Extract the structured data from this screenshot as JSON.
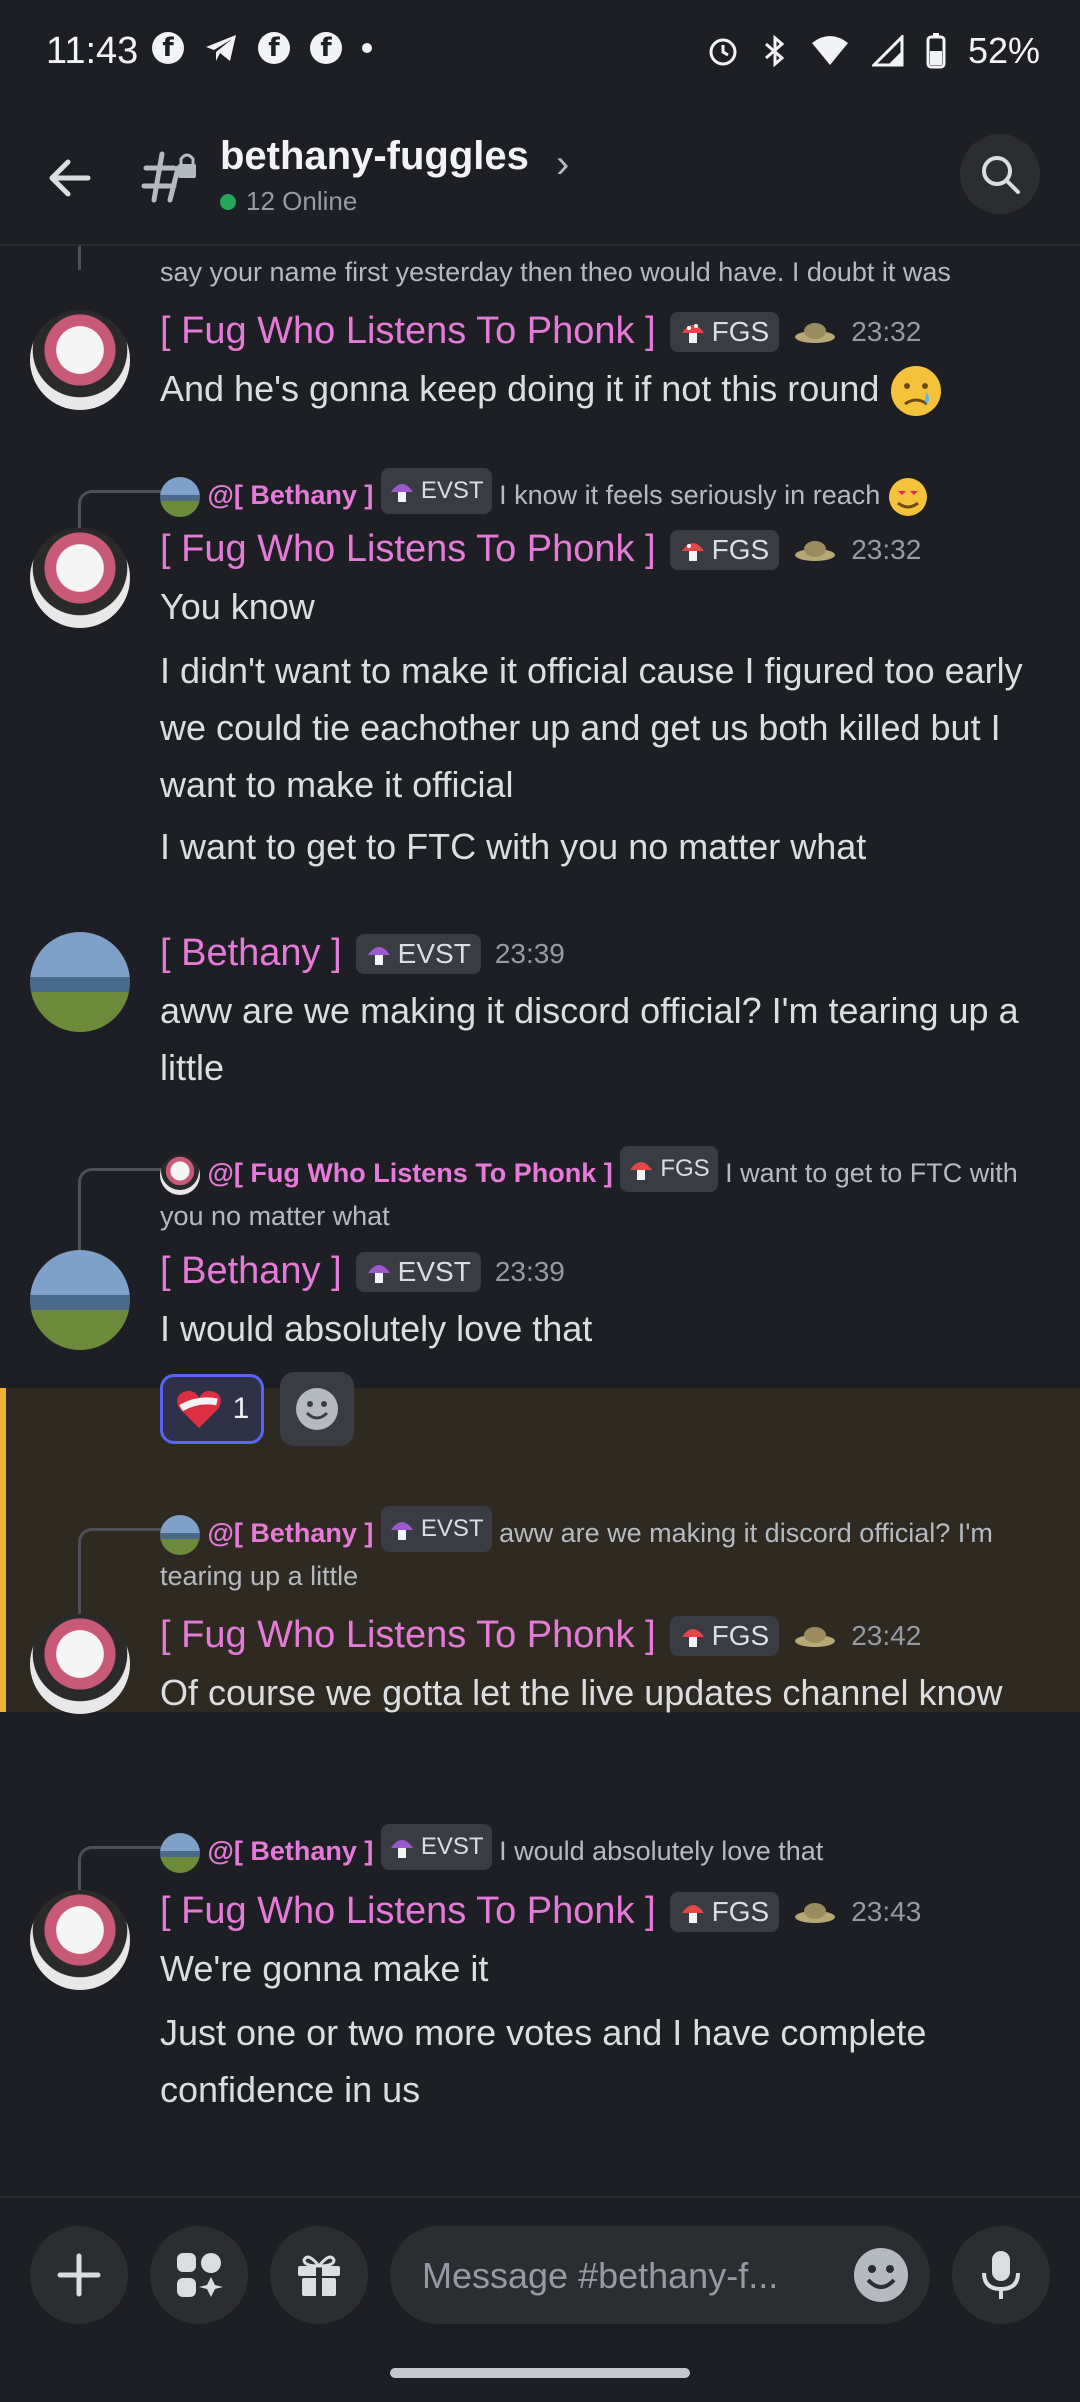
{
  "status_bar": {
    "time": "11:43",
    "battery": "52%"
  },
  "header": {
    "channel_name": "bethany-fuggles",
    "online": "12 Online"
  },
  "messages": [
    {
      "cont_text": "say your name first yesterday then theo would have. I doubt it was"
    },
    {
      "author": "[ Fug Who Listens To Phonk ]",
      "badge": "FGS",
      "time": "23:32",
      "text": "And he's gonna keep doing it if not this round"
    },
    {
      "reply_author": "@[ Bethany ]",
      "reply_badge": "EVST",
      "reply_text": "I know it feels seriously in reach",
      "author": "[ Fug Who Listens To Phonk ]",
      "badge": "FGS",
      "time": "23:32",
      "lines": [
        "You know",
        "I didn't want to make it official cause I figured too early we could tie eachother up and get us both killed but I want to make it official",
        "I want to get to FTC with you no matter what"
      ]
    },
    {
      "author": "[ Bethany ]",
      "badge": "EVST",
      "time": "23:39",
      "text": "aww are we making it discord official? I'm tearing up a little"
    },
    {
      "reply_author": "@[ Fug Who Listens To Phonk ]",
      "reply_badge": "FGS",
      "reply_text": "I want to get to FTC with you no matter what",
      "author": "[ Bethany ]",
      "badge": "EVST",
      "time": "23:39",
      "text": "I would absolutely love that",
      "reaction_count": "1"
    },
    {
      "reply_author": "@[ Bethany ]",
      "reply_badge": "EVST",
      "reply_text": "aww are we making it discord official? I'm tearing up a little",
      "author": "[ Fug Who Listens To Phonk ]",
      "badge": "FGS",
      "time": "23:42",
      "text": "Of course we gotta let the  live updates channel know"
    },
    {
      "reply_author": "@[ Bethany ]",
      "reply_badge": "EVST",
      "reply_text": "I would absolutely love that",
      "author": "[ Fug Who Listens To Phonk ]",
      "badge": "FGS",
      "time": "23:43",
      "lines": [
        "We're gonna make it",
        "Just one or two more votes and I have complete confidence in us"
      ]
    }
  ],
  "composer": {
    "placeholder": "Message #bethany-f..."
  },
  "icons": [
    "back-arrow-icon",
    "channel-lock-icon",
    "search-icon",
    "plus-icon",
    "apps-icon",
    "gift-icon",
    "emoji-icon",
    "microphone-icon"
  ],
  "colors": {
    "username": "#e67ad8",
    "background": "#1e1f25",
    "highlight": "#2f2a21",
    "accent": "#5865f2",
    "online": "#23a55a"
  }
}
